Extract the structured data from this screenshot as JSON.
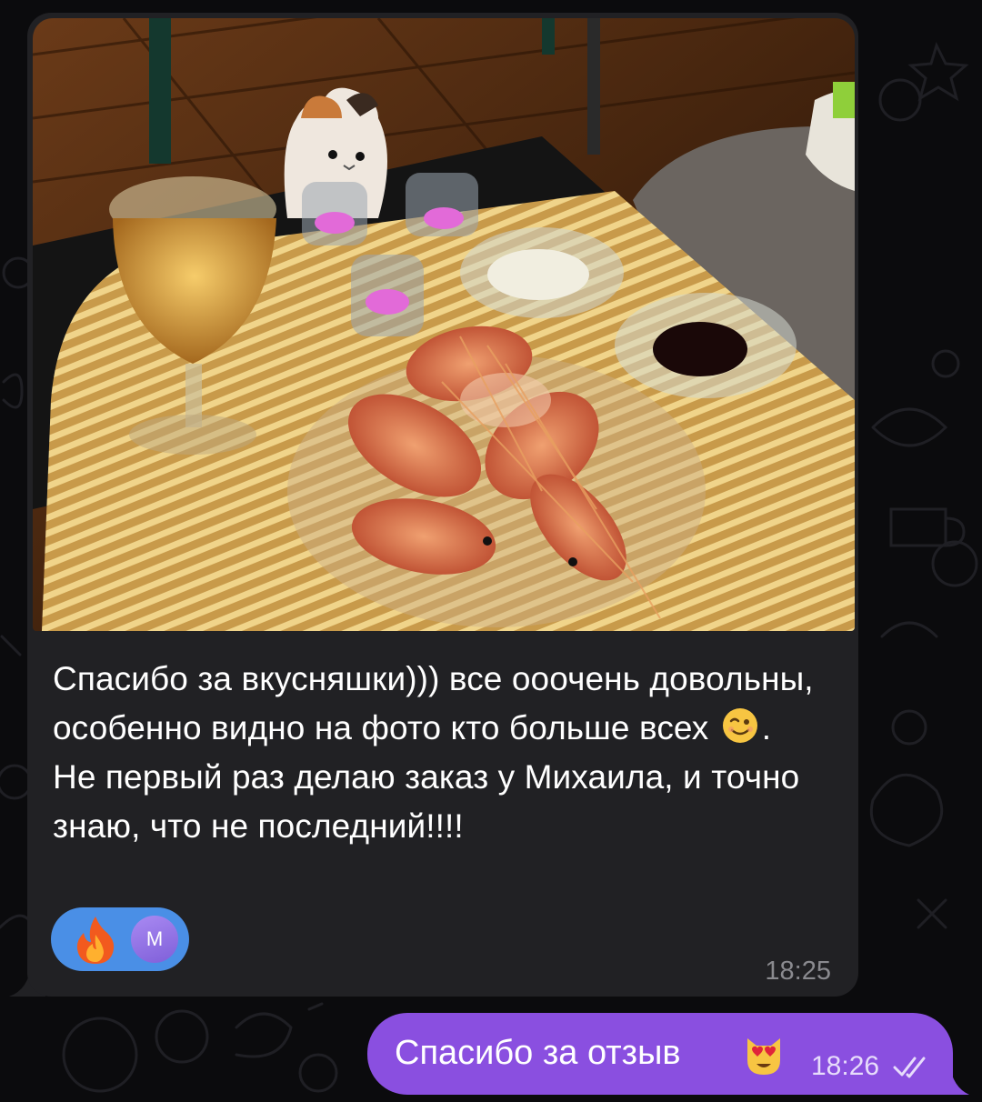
{
  "incoming_message": {
    "photo_alt_icon": "food-photo",
    "text_part1": "Спасибо за вкусняшки))) все ооочень довольны, особенно видно на фото кто больше всех ",
    "text_part2": ". Не первый раз делаю заказ у Михаила, и точно знаю, что не последний!!!!",
    "inline_emoji": "winking-face-icon",
    "reactions": {
      "emoji": "fire-icon",
      "avatar_initial": "М"
    },
    "time": "18:25"
  },
  "outgoing_message": {
    "text": "Спасибо за отзыв",
    "emoji": "heart-eyes-cat-icon",
    "time": "18:26",
    "status_icon": "double-check-icon"
  },
  "colors": {
    "incoming_bubble": "#212124",
    "outgoing_bubble": "#8a4fe0",
    "reaction_pill": "#4a8fe6",
    "background": "#0b0b0d"
  }
}
